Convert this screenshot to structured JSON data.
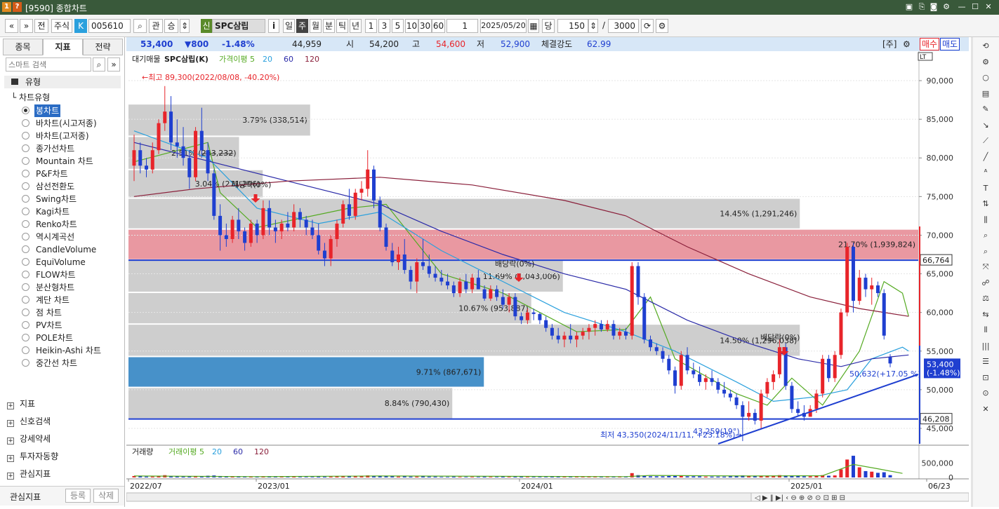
{
  "window": {
    "code": "[9590]",
    "title": "종합차트"
  },
  "toolbar": {
    "jeon": "전",
    "stock_type": "주식",
    "k_badge": "K",
    "code": "005610",
    "kwan": "관",
    "seung": "승",
    "sin_badge": "신",
    "name": "SPC삼립",
    "info": "i",
    "periods": [
      "일",
      "주",
      "월",
      "분",
      "틱",
      "년"
    ],
    "selected_period": "주",
    "minutes": [
      "1",
      "3",
      "5",
      "10",
      "30",
      "60"
    ],
    "interval": "1",
    "date": "2025/05/20",
    "dang": "당",
    "count": "150",
    "slash": "/",
    "max": "3000"
  },
  "left_panel": {
    "tabs": [
      "종목",
      "지표",
      "전략"
    ],
    "active_tab": "지표",
    "search_placeholder": "스마트 검색",
    "group_title": "유형",
    "chart_type_label": "차트유형",
    "chart_types": [
      "봉차트",
      "바차트(시고저종)",
      "바차트(고저종)",
      "종가선차트",
      "Mountain 차트",
      "P&F차트",
      "삼선전환도",
      "Swing차트",
      "Kagi차트",
      "Renko차트",
      "역시계곡선",
      "CandleVolume",
      "EquiVolume",
      "FLOW차트",
      "분산형차트",
      "계단 차트",
      "점 차트",
      "PV차트",
      "POLE차트",
      "Heikin-Ashi 차트",
      "중간선 차트"
    ],
    "selected_chart_type": "봉차트",
    "sections": [
      "지표",
      "신호검색",
      "강세약세",
      "투자자동향",
      "관심지표"
    ],
    "footer_label": "관심지표",
    "btn_register": "등록",
    "btn_delete": "삭제"
  },
  "info_bar": {
    "price": "53,400",
    "change": "▼800",
    "change_pct": "-1.48%",
    "volume": "44,959",
    "open_label": "시",
    "open": "54,200",
    "high_label": "고",
    "high": "54,600",
    "low_label": "저",
    "low": "52,900",
    "strength_label": "체결강도",
    "strength": "62.99",
    "ju": "[주]",
    "buy": "매수",
    "sell": "매도"
  },
  "colors": {
    "up": "#e8242a",
    "down": "#1f3fd0",
    "ma5": "#55aa22",
    "ma20": "#2aa0dd",
    "ma60": "#2a2aa8",
    "ma120": "#8a1f3a",
    "accent": "#2b6cc4"
  },
  "chart_data": {
    "type": "candlestick",
    "title": "SPC삼립(K)",
    "price_legend": [
      "대기매물",
      "SPC삼립(K)",
      "가격이평 5",
      "20",
      "60",
      "120"
    ],
    "volume_legend": [
      "거래량",
      "거래이평 5",
      "20",
      "60",
      "120"
    ],
    "y_ticks": [
      "90,000",
      "85,000",
      "80,000",
      "75,000",
      "70,000",
      "65,000",
      "60,000",
      "55,000",
      "50,000",
      "45,000"
    ],
    "ylim": [
      43000,
      92000
    ],
    "x_labels": [
      "2022/07",
      "2023/01",
      "2024/01",
      "2025/01",
      "06/23"
    ],
    "volume_ticks": [
      "500,000",
      "0"
    ],
    "candles_ohlc": [
      [
        79000,
        83000,
        77000,
        81000
      ],
      [
        81000,
        82000,
        78000,
        79000
      ],
      [
        79000,
        80000,
        77500,
        78500
      ],
      [
        78500,
        82000,
        78000,
        81000
      ],
      [
        81000,
        85000,
        80500,
        84500
      ],
      [
        84500,
        89300,
        83500,
        86000
      ],
      [
        86000,
        88000,
        81000,
        82000
      ],
      [
        82000,
        85000,
        80000,
        81500
      ],
      [
        81500,
        84000,
        79000,
        80000
      ],
      [
        80000,
        81000,
        76000,
        77500
      ],
      [
        77500,
        84000,
        77000,
        83500
      ],
      [
        83500,
        86500,
        80000,
        81000
      ],
      [
        81000,
        82000,
        77000,
        78000
      ],
      [
        78000,
        78500,
        72000,
        72500
      ],
      [
        72500,
        74000,
        68000,
        70000
      ],
      [
        70000,
        71500,
        68500,
        69500
      ],
      [
        69500,
        72500,
        69000,
        72000
      ],
      [
        72000,
        73500,
        69500,
        70500
      ],
      [
        70500,
        71000,
        68000,
        69000
      ],
      [
        69000,
        72000,
        68500,
        71500
      ],
      [
        71500,
        72000,
        69000,
        70000
      ],
      [
        70000,
        74500,
        69500,
        73500
      ],
      [
        73500,
        74500,
        70000,
        71000
      ],
      [
        71000,
        72000,
        69000,
        70500
      ],
      [
        70500,
        72000,
        69500,
        71500
      ],
      [
        71500,
        73000,
        70500,
        71000
      ],
      [
        71000,
        74000,
        70500,
        73000
      ],
      [
        73000,
        73500,
        71000,
        72000
      ],
      [
        72000,
        72500,
        70000,
        71000
      ],
      [
        71000,
        72000,
        69500,
        70000
      ],
      [
        70000,
        71500,
        67500,
        68000
      ],
      [
        68000,
        69000,
        66000,
        67000
      ],
      [
        67000,
        70000,
        66000,
        69500
      ],
      [
        69500,
        72000,
        68500,
        71500
      ],
      [
        71500,
        74500,
        71000,
        74000
      ],
      [
        74000,
        76000,
        72000,
        72500
      ],
      [
        72500,
        76000,
        72000,
        75500
      ],
      [
        75500,
        77000,
        74500,
        76000
      ],
      [
        76000,
        81000,
        75000,
        78500
      ],
      [
        78500,
        79000,
        73500,
        74500
      ],
      [
        74500,
        75000,
        70500,
        71000
      ],
      [
        71000,
        71500,
        68000,
        68500
      ],
      [
        68000,
        69000,
        66000,
        66500
      ],
      [
        66500,
        68500,
        65500,
        67500
      ],
      [
        67500,
        69500,
        65000,
        65500
      ],
      [
        65500,
        66000,
        63000,
        64000
      ],
      [
        64000,
        67000,
        62500,
        66500
      ],
      [
        66500,
        69500,
        65500,
        66000
      ],
      [
        66000,
        67500,
        64500,
        65000
      ],
      [
        65000,
        66000,
        64000,
        64500
      ],
      [
        64500,
        65500,
        63500,
        64000
      ],
      [
        64000,
        65000,
        63000,
        63500
      ],
      [
        63500,
        64000,
        62000,
        62500
      ],
      [
        62500,
        64500,
        62000,
        64000
      ],
      [
        64000,
        65000,
        62500,
        63000
      ],
      [
        63000,
        65000,
        62500,
        64500
      ],
      [
        64500,
        65500,
        63000,
        63000
      ],
      [
        63000,
        63500,
        61500,
        61800
      ],
      [
        61800,
        63500,
        61500,
        63000
      ],
      [
        63000,
        63500,
        61500,
        62000
      ],
      [
        62000,
        63000,
        60500,
        61000
      ],
      [
        61000,
        62500,
        60000,
        62000
      ],
      [
        62000,
        62500,
        59000,
        59500
      ],
      [
        59500,
        60000,
        58500,
        59000
      ],
      [
        59000,
        60500,
        58500,
        60000
      ],
      [
        60000,
        60500,
        59000,
        59800
      ],
      [
        59800,
        60000,
        58500,
        59000
      ],
      [
        59000,
        59500,
        57500,
        58000
      ],
      [
        58000,
        58500,
        56500,
        57000
      ],
      [
        57000,
        58000,
        56000,
        56500
      ],
      [
        56500,
        57500,
        55500,
        57000
      ],
      [
        57000,
        58500,
        56000,
        56500
      ],
      [
        56500,
        57500,
        55500,
        57000
      ],
      [
        57000,
        58000,
        56500,
        57500
      ],
      [
        57500,
        58500,
        56500,
        58000
      ],
      [
        58000,
        59000,
        57000,
        58500
      ],
      [
        58500,
        59000,
        57500,
        57800
      ],
      [
        57800,
        59000,
        57500,
        58500
      ],
      [
        58500,
        59000,
        56500,
        57000
      ],
      [
        57000,
        58000,
        56500,
        57500
      ],
      [
        57500,
        58000,
        56500,
        57000
      ],
      [
        57000,
        66500,
        56500,
        66000
      ],
      [
        66000,
        66500,
        61000,
        62000
      ],
      [
        62000,
        62500,
        56000,
        56500
      ],
      [
        56500,
        57000,
        55000,
        55500
      ],
      [
        55500,
        56000,
        54500,
        55000
      ],
      [
        55000,
        55500,
        53500,
        54000
      ],
      [
        54000,
        54500,
        52000,
        52500
      ],
      [
        52500,
        53000,
        49500,
        50500
      ],
      [
        50500,
        55000,
        50000,
        54500
      ],
      [
        54500,
        55500,
        52000,
        52500
      ],
      [
        52500,
        53500,
        51500,
        52000
      ],
      [
        52000,
        53000,
        50500,
        51000
      ],
      [
        51000,
        52000,
        50000,
        51500
      ],
      [
        51500,
        52500,
        50500,
        51000
      ],
      [
        51000,
        51500,
        49500,
        50000
      ],
      [
        50000,
        51000,
        49000,
        49500
      ],
      [
        49500,
        50000,
        48500,
        49000
      ],
      [
        49000,
        49500,
        47500,
        48000
      ],
      [
        48000,
        48500,
        43350,
        46500
      ],
      [
        46500,
        48500,
        46000,
        47000
      ],
      [
        47000,
        47500,
        45500,
        46000
      ],
      [
        46000,
        50000,
        45000,
        49500
      ],
      [
        49500,
        51500,
        49000,
        51000
      ],
      [
        51000,
        52500,
        50000,
        52000
      ],
      [
        52000,
        56500,
        51500,
        55500
      ],
      [
        55500,
        56000,
        50000,
        50500
      ],
      [
        50500,
        51000,
        47000,
        47500
      ],
      [
        47500,
        48500,
        46500,
        47000
      ],
      [
        47000,
        48000,
        46000,
        46500
      ],
      [
        46500,
        48000,
        46500,
        47500
      ],
      [
        47500,
        50000,
        47000,
        49500
      ],
      [
        49500,
        54500,
        49000,
        54000
      ],
      [
        54000,
        54500,
        51000,
        51500
      ],
      [
        51500,
        55000,
        51000,
        54500
      ],
      [
        54500,
        60500,
        54000,
        60000
      ],
      [
        60000,
        69000,
        59500,
        68500
      ],
      [
        68500,
        69000,
        60000,
        61500
      ],
      [
        61500,
        65500,
        61000,
        64500
      ],
      [
        64500,
        65000,
        62000,
        63000
      ],
      [
        63000,
        64500,
        61000,
        63500
      ],
      [
        63500,
        64000,
        62000,
        62500
      ],
      [
        62500,
        63000,
        56500,
        57000
      ],
      [
        54200,
        54600,
        52900,
        53400
      ]
    ],
    "moving_averages": [
      {
        "name": "5",
        "values": [
          [
            0,
            79500
          ],
          [
            12,
            82000
          ],
          [
            14,
            75500
          ],
          [
            20,
            71000
          ],
          [
            35,
            73500
          ],
          [
            41,
            74000
          ],
          [
            50,
            65000
          ],
          [
            60,
            62500
          ],
          [
            72,
            57500
          ],
          [
            80,
            57800
          ],
          [
            84,
            62000
          ],
          [
            88,
            54000
          ],
          [
            98,
            49500
          ],
          [
            103,
            48000
          ],
          [
            107,
            51500
          ],
          [
            112,
            48000
          ],
          [
            118,
            55000
          ],
          [
            122,
            64000
          ],
          [
            125,
            62500
          ],
          [
            126,
            59500
          ]
        ]
      },
      {
        "name": "20",
        "values": [
          [
            0,
            83500
          ],
          [
            12,
            80000
          ],
          [
            20,
            73500
          ],
          [
            30,
            71500
          ],
          [
            40,
            73000
          ],
          [
            50,
            68000
          ],
          [
            60,
            64000
          ],
          [
            70,
            60000
          ],
          [
            80,
            57500
          ],
          [
            88,
            55000
          ],
          [
            98,
            51000
          ],
          [
            104,
            48500
          ],
          [
            110,
            49000
          ],
          [
            116,
            50000
          ],
          [
            120,
            54000
          ],
          [
            125,
            55500
          ],
          [
            126,
            55000
          ]
        ]
      },
      {
        "name": "60",
        "values": [
          [
            0,
            82000
          ],
          [
            10,
            80000
          ],
          [
            25,
            77000
          ],
          [
            40,
            74000
          ],
          [
            50,
            70500
          ],
          [
            60,
            67500
          ],
          [
            70,
            65000
          ],
          [
            80,
            63000
          ],
          [
            90,
            59000
          ],
          [
            100,
            56000
          ],
          [
            108,
            54000
          ],
          [
            115,
            53000
          ],
          [
            120,
            54000
          ],
          [
            126,
            54500
          ]
        ]
      },
      {
        "name": "120",
        "values": [
          [
            0,
            75000
          ],
          [
            10,
            76000
          ],
          [
            25,
            77000
          ],
          [
            40,
            77500
          ],
          [
            55,
            76500
          ],
          [
            70,
            74500
          ],
          [
            80,
            72500
          ],
          [
            90,
            68500
          ],
          [
            100,
            65000
          ],
          [
            110,
            62000
          ],
          [
            118,
            60500
          ],
          [
            126,
            59500
          ]
        ]
      }
    ],
    "supply_zones": [
      {
        "label": "3.79% (338,514)",
        "top": 87000,
        "bottom": 82800,
        "frac": 0.23
      },
      {
        "label": "2.51% (2̶6̶3̶,2̶3̶2̶)",
        "top": 82800,
        "bottom": 78500,
        "frac": 0.14
      },
      {
        "label": "3.04% (271,296)",
        "top": 78500,
        "bottom": 74800,
        "frac": 0.17
      },
      {
        "label": "14.45% (1,291,246)",
        "top": 74800,
        "bottom": 70800,
        "frac": 0.85
      },
      {
        "label": "21.70% (1,939,824)",
        "top": 70800,
        "bottom": 66800,
        "frac": 1.0,
        "highlight": "pink"
      },
      {
        "label": "11.69% (1,043,006)",
        "top": 66800,
        "bottom": 62600,
        "frac": 0.55
      },
      {
        "label": "10.67% (953,887)",
        "top": 62600,
        "bottom": 58500,
        "frac": 0.51
      },
      {
        "label": "14.50% (1,296,038)",
        "top": 58500,
        "bottom": 54300,
        "frac": 0.85
      },
      {
        "label": "9.71% (867,671)",
        "top": 54300,
        "bottom": 50300,
        "frac": 0.45,
        "highlight": "blue"
      },
      {
        "label": "8.84% (790,430)",
        "top": 50300,
        "bottom": 46200,
        "frac": 0.41
      }
    ],
    "hlines": [
      {
        "value": 66764,
        "label": "66,764"
      },
      {
        "value": 46208,
        "label": "46,208"
      }
    ],
    "current_price_label": [
      "53,400",
      "(-1.48%)"
    ],
    "annotations": {
      "high": "←최고 89,300(2022/08/08, -40.20%)",
      "low": "최저 43,350(2024/11/11, +23.18%)→",
      "trend": "50,632(+17.05 %)",
      "angle": "43,259(19°)",
      "dividend": "배당락(0%)"
    },
    "volumes": [
      0.05,
      0.04,
      0.03,
      0.03,
      0.05,
      0.08,
      0.05,
      0.04,
      0.03,
      0.04,
      0.05,
      0.04,
      0.06,
      0.07,
      0.05,
      0.03,
      0.03,
      0.03,
      0.03,
      0.03,
      0.03,
      0.04,
      0.03,
      0.03,
      0.02,
      0.02,
      0.03,
      0.02,
      0.02,
      0.02,
      0.03,
      0.03,
      0.03,
      0.04,
      0.05,
      0.05,
      0.06,
      0.05,
      0.07,
      0.06,
      0.04,
      0.04,
      0.04,
      0.03,
      0.04,
      0.03,
      0.03,
      0.04,
      0.03,
      0.03,
      0.02,
      0.02,
      0.03,
      0.02,
      0.02,
      0.02,
      0.02,
      0.03,
      0.02,
      0.02,
      0.03,
      0.02,
      0.03,
      0.03,
      0.02,
      0.02,
      0.02,
      0.02,
      0.03,
      0.03,
      0.02,
      0.02,
      0.02,
      0.02,
      0.02,
      0.02,
      0.02,
      0.02,
      0.02,
      0.02,
      0.02,
      0.15,
      0.08,
      0.06,
      0.04,
      0.04,
      0.04,
      0.05,
      0.06,
      0.06,
      0.04,
      0.04,
      0.04,
      0.03,
      0.03,
      0.03,
      0.03,
      0.04,
      0.05,
      0.07,
      0.05,
      0.04,
      0.05,
      0.06,
      0.05,
      0.08,
      0.07,
      0.06,
      0.05,
      0.04,
      0.04,
      0.05,
      0.08,
      0.06,
      0.07,
      0.28,
      0.62,
      0.75,
      0.35,
      0.22,
      0.2,
      0.16,
      0.18,
      0.08
    ],
    "volume_ma5": [
      [
        0,
        0.05
      ],
      [
        20,
        0.03
      ],
      [
        40,
        0.05
      ],
      [
        80,
        0.03
      ],
      [
        84,
        0.07
      ],
      [
        100,
        0.05
      ],
      [
        112,
        0.06
      ],
      [
        117,
        0.45
      ],
      [
        121,
        0.3
      ],
      [
        125,
        0.14
      ]
    ]
  }
}
